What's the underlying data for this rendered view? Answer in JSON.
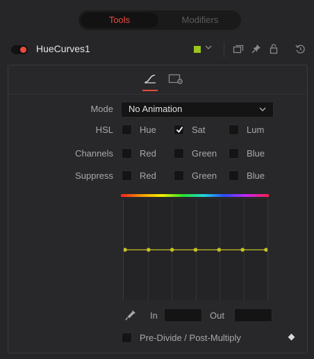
{
  "tabs": {
    "tools": "Tools",
    "modifiers": "Modifiers"
  },
  "node": {
    "name": "HueCurves1",
    "color": "#9ac51c"
  },
  "controls": {
    "mode_label": "Mode",
    "mode_value": "No Animation",
    "hsl_label": "HSL",
    "hsl": [
      {
        "label": "Hue",
        "checked": false
      },
      {
        "label": "Sat",
        "checked": true
      },
      {
        "label": "Lum",
        "checked": false
      }
    ],
    "channels_label": "Channels",
    "channels": [
      {
        "label": "Red",
        "checked": false
      },
      {
        "label": "Green",
        "checked": false
      },
      {
        "label": "Blue",
        "checked": false
      }
    ],
    "suppress_label": "Suppress",
    "suppress": [
      {
        "label": "Red",
        "checked": false
      },
      {
        "label": "Green",
        "checked": false
      },
      {
        "label": "Blue",
        "checked": false
      }
    ],
    "in_label": "In",
    "in_value": "",
    "out_label": "Out",
    "out_value": "",
    "predivide_label": "Pre-Divide / Post-Multiply",
    "predivide_checked": false
  },
  "curve": {
    "points": 7,
    "level": 0.5,
    "curve_color": "#c8c226"
  },
  "colors": {
    "accent": "#e34b3c"
  },
  "icons": {
    "toggle": "power-toggle-icon",
    "chip_dropdown": "chevron-down-icon",
    "view": "window-icon",
    "pin": "pin-icon",
    "lock": "lock-icon",
    "reset": "reset-icon",
    "curves_tab": "curve-icon",
    "settings_tab": "settings-icon",
    "picker": "eyedropper-icon",
    "keyframe": "keyframe-diamond-icon"
  }
}
